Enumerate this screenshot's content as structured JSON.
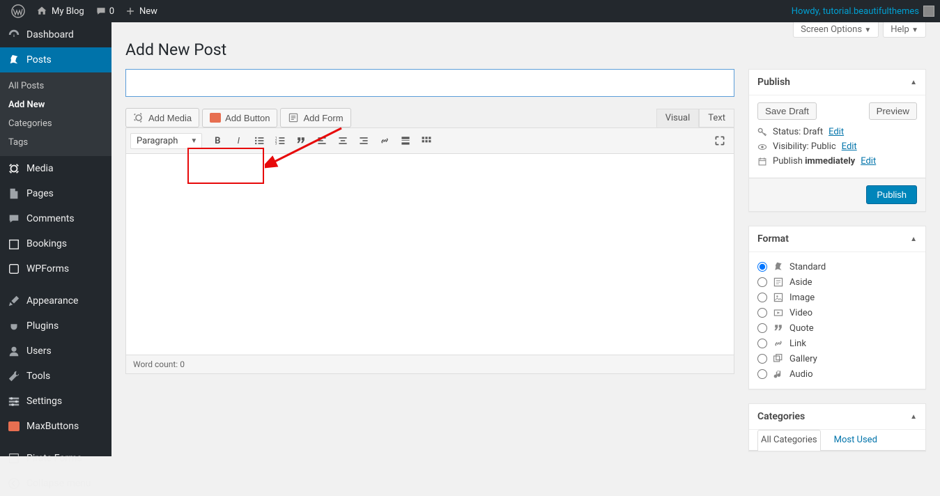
{
  "adminbar": {
    "site_name": "My Blog",
    "comments_count": "0",
    "new_label": "New",
    "howdy_prefix": "Howdy, ",
    "user_name": "tutorial.beautifulthemes"
  },
  "sidebar": {
    "items": [
      {
        "label": "Dashboard"
      },
      {
        "label": "Posts",
        "active": true,
        "submenu": [
          {
            "label": "All Posts"
          },
          {
            "label": "Add New",
            "current": true
          },
          {
            "label": "Categories"
          },
          {
            "label": "Tags"
          }
        ]
      },
      {
        "label": "Media"
      },
      {
        "label": "Pages"
      },
      {
        "label": "Comments"
      },
      {
        "label": "Bookings"
      },
      {
        "label": "WPForms"
      },
      {
        "label": "Appearance"
      },
      {
        "label": "Plugins"
      },
      {
        "label": "Users"
      },
      {
        "label": "Tools"
      },
      {
        "label": "Settings"
      },
      {
        "label": "MaxButtons"
      },
      {
        "label": "Pirate Forms"
      },
      {
        "label": "Collapse menu"
      }
    ]
  },
  "screen_meta": {
    "screen_options": "Screen Options",
    "help": "Help"
  },
  "page": {
    "title": "Add New Post",
    "title_input_value": ""
  },
  "media_buttons": {
    "add_media": "Add Media",
    "add_button": "Add Button",
    "add_form": "Add Form"
  },
  "editor": {
    "tabs": {
      "visual": "Visual",
      "text": "Text"
    },
    "format_select": "Paragraph",
    "word_count_label": "Word count: ",
    "word_count": "0"
  },
  "publish": {
    "heading": "Publish",
    "save_draft": "Save Draft",
    "preview": "Preview",
    "status_label": "Status: ",
    "status_value": "Draft",
    "visibility_label": "Visibility: ",
    "visibility_value": "Public",
    "publish_label": "Publish ",
    "publish_time": "immediately",
    "edit": "Edit",
    "submit": "Publish"
  },
  "format": {
    "heading": "Format",
    "options": [
      "Standard",
      "Aside",
      "Image",
      "Video",
      "Quote",
      "Link",
      "Gallery",
      "Audio"
    ],
    "selected": "Standard"
  },
  "categories": {
    "heading": "Categories",
    "tabs": {
      "all": "All Categories",
      "most": "Most Used"
    }
  }
}
